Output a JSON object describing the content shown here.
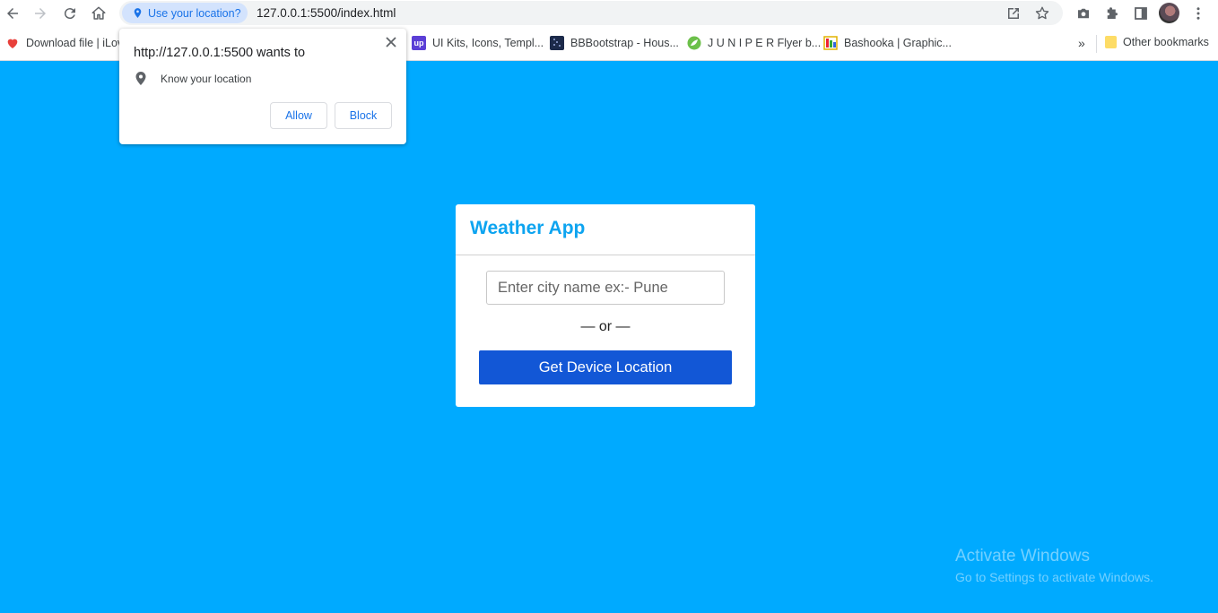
{
  "browser": {
    "site_chip_label": "Use your location?",
    "url": "127.0.0.1:5500/index.html",
    "bookmarks": [
      {
        "label": "Download file | iLov",
        "icon": "heart-icon",
        "color": "#e8403b"
      },
      {
        "label": "UI Kits, Icons, Templ...",
        "icon": "up-icon",
        "color": "#5b3fd6"
      },
      {
        "label": "BBBootstrap - Hous...",
        "icon": "bbbootstrap-icon",
        "color": "#1c2a4a"
      },
      {
        "label": "J U N I P E R Flyer b...",
        "icon": "leaf-icon",
        "color": "#6cc04a"
      },
      {
        "label": "Bashooka | Graphic...",
        "icon": "bashooka-icon",
        "color": "#e2b300"
      }
    ],
    "overflow_label": "»",
    "other_bookmarks_label": "Other bookmarks"
  },
  "permission_popup": {
    "title": "http://127.0.0.1:5500 wants to",
    "permission_text": "Know your location",
    "allow_label": "Allow",
    "block_label": "Block"
  },
  "weather_card": {
    "title": "Weather App",
    "input_placeholder": "Enter city name ex:- Pune",
    "separator": "— or —",
    "button_label": "Get Device Location"
  },
  "watermark": {
    "title": "Activate Windows",
    "subtitle": "Go to Settings to activate Windows."
  },
  "colors": {
    "page_bg": "#00aaff",
    "title_color": "#0da4f0",
    "button_bg": "#1257d6"
  }
}
